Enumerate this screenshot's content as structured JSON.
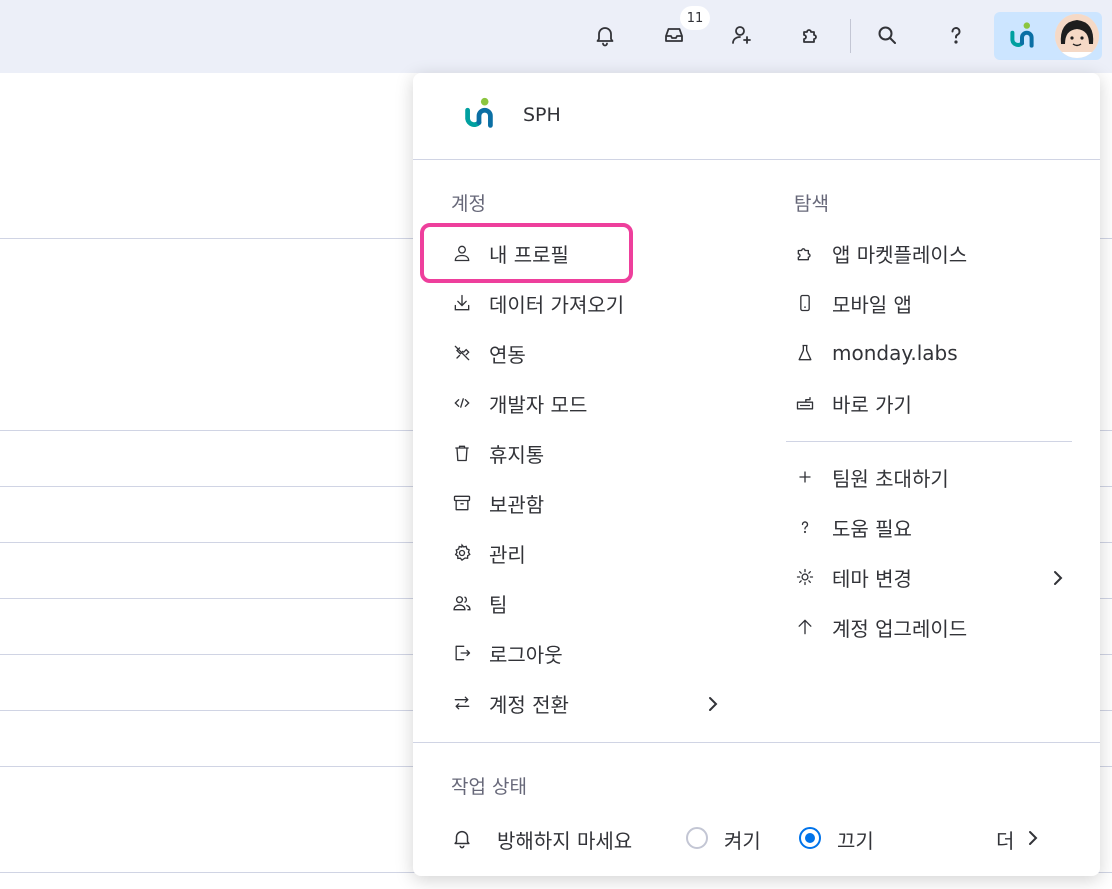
{
  "topbar": {
    "inbox_badge": "11",
    "icons": [
      "bell-icon",
      "inbox-icon",
      "invite-user-icon",
      "apps-icon",
      "search-icon",
      "help-icon"
    ]
  },
  "workspace": {
    "name": "SPH"
  },
  "account": {
    "title": "계정",
    "items": [
      {
        "label": "내 프로필",
        "icon": "person-icon"
      },
      {
        "label": "데이터 가져오기",
        "icon": "download-icon"
      },
      {
        "label": "연동",
        "icon": "integration-icon"
      },
      {
        "label": "개발자 모드",
        "icon": "code-icon"
      },
      {
        "label": "휴지통",
        "icon": "trash-icon"
      },
      {
        "label": "보관함",
        "icon": "archive-icon"
      },
      {
        "label": "관리",
        "icon": "gear-icon"
      },
      {
        "label": "팀",
        "icon": "team-icon"
      },
      {
        "label": "로그아웃",
        "icon": "logout-icon"
      },
      {
        "label": "계정 전환",
        "icon": "switch-icon"
      }
    ]
  },
  "explore": {
    "title": "탐색",
    "items": [
      {
        "label": "앱 마켓플레이스",
        "icon": "puzzle-icon"
      },
      {
        "label": "모바일 앱",
        "icon": "mobile-icon"
      },
      {
        "label": "monday.labs",
        "icon": "flask-icon"
      },
      {
        "label": "바로 가기",
        "icon": "keyboard-icon"
      }
    ],
    "more": [
      {
        "label": "팀원 초대하기",
        "icon": "plus-icon"
      },
      {
        "label": "도움 필요",
        "icon": "question-icon"
      },
      {
        "label": "테마 변경",
        "icon": "sun-icon"
      },
      {
        "label": "계정 업그레이드",
        "icon": "arrow-up-icon"
      }
    ]
  },
  "status": {
    "title": "작업 상태",
    "dnd_label": "방해하지 마세요",
    "on_label": "켜기",
    "off_label": "끄기",
    "selected": "off",
    "more_label": "더"
  },
  "colors": {
    "accent": "#0073ea",
    "highlight": "#ee3f9c",
    "account_btn_bg": "#cce5ff"
  }
}
